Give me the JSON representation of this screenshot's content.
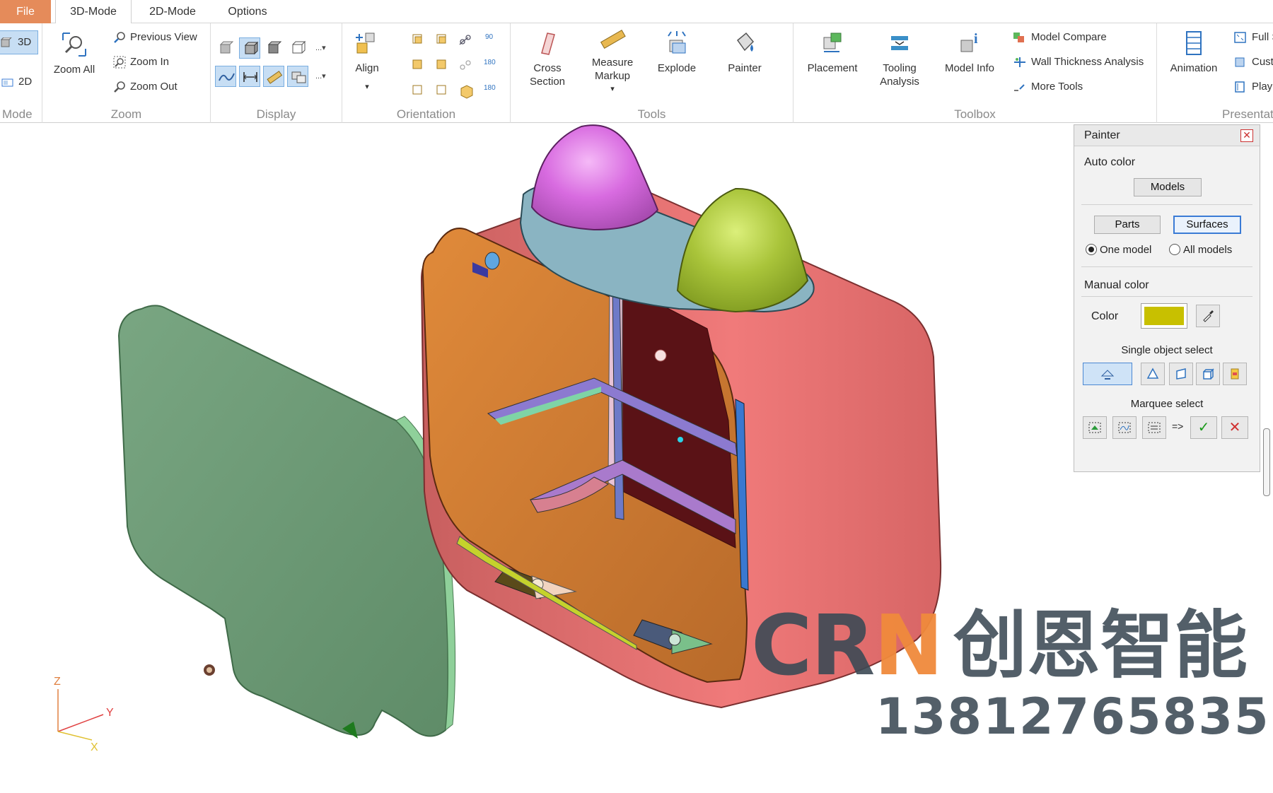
{
  "tabs": {
    "file": "File",
    "mode3d": "3D-Mode",
    "mode2d": "2D-Mode",
    "options": "Options"
  },
  "ribbon": {
    "mode": {
      "label": "Mode",
      "btn3d": "3D",
      "btn2d": "2D"
    },
    "zoom": {
      "label": "Zoom",
      "zoom_all": "Zoom All",
      "previous_view": "Previous View",
      "zoom_in": "Zoom In",
      "zoom_out": "Zoom Out"
    },
    "display": {
      "label": "Display",
      "more": "..."
    },
    "orientation": {
      "label": "Orientation",
      "align": "Align"
    },
    "tools": {
      "label": "Tools",
      "cross_section": "Cross\nSection",
      "measure_markup": "Measure\nMarkup",
      "explode": "Explode",
      "painter": "Painter"
    },
    "toolbox": {
      "label": "Toolbox",
      "placement": "Placement",
      "tooling_analysis": "Tooling\nAnalysis",
      "model_info": "Model Info",
      "model_compare": "Model Compare",
      "wall_thickness": "Wall Thickness Analysis",
      "more_tools": "More Tools"
    },
    "presentation": {
      "label": "Presentat",
      "animation": "Animation",
      "full": "Full S",
      "cust": "Cust",
      "play": "Play"
    }
  },
  "painter": {
    "title": "Painter",
    "auto_color": "Auto color",
    "models": "Models",
    "parts": "Parts",
    "surfaces": "Surfaces",
    "one_model": "One model",
    "all_models": "All models",
    "manual_color": "Manual color",
    "color_label": "Color",
    "color_value": "#c8c000",
    "single_select": "Single object select",
    "marquee_select": "Marquee select",
    "arrow": "=>"
  },
  "axes": {
    "z": "Z",
    "y": "Y",
    "x": "X"
  },
  "watermark": {
    "crn_c": "CR",
    "crn_n": "N",
    "chinese": "创恩智能",
    "phone": "13812765835"
  },
  "colors": {
    "accent_file": "#e58b5a",
    "selected_blue": "#3a7bd5",
    "shell_red": "#e07070",
    "interior_orange": "#e8973f",
    "cover_green": "#6e9c76",
    "knob_magenta": "#d569d8",
    "knob_green": "#a9c43a"
  }
}
